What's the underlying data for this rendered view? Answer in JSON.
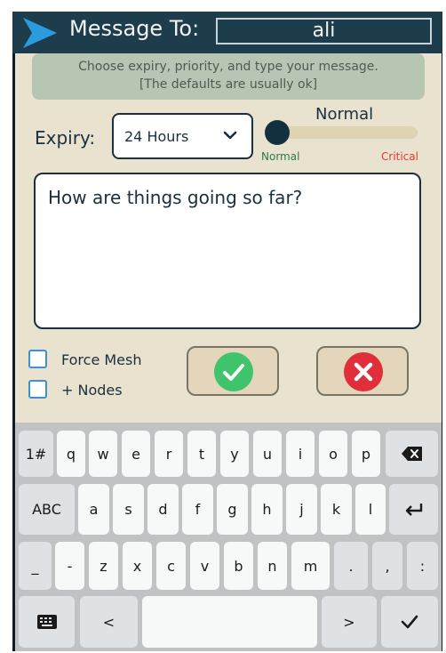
{
  "header": {
    "title": "Message To:",
    "recipient": "ali"
  },
  "hint": {
    "line1": "Choose expiry, priority, and type your message.",
    "line2": "[The defaults are usually ok]"
  },
  "expiry": {
    "label": "Expiry:",
    "selected": "24 Hours"
  },
  "priority": {
    "title": "Normal",
    "min_label": "Normal",
    "max_label": "Critical",
    "level": 0
  },
  "message": {
    "text": "How are things going so far?"
  },
  "options": {
    "force_mesh": "Force Mesh",
    "plus_nodes": "+ Nodes"
  },
  "colors": {
    "header": "#1d3d4c",
    "panel": "#e8e2cf",
    "accent_arrow": "#2b9be0",
    "confirm": "#3fc46b",
    "cancel": "#e02f3a"
  },
  "keyboard": {
    "row1": [
      "1#",
      "q",
      "w",
      "e",
      "r",
      "t",
      "y",
      "u",
      "i",
      "o",
      "p"
    ],
    "row2": [
      "ABC",
      "a",
      "s",
      "d",
      "f",
      "g",
      "h",
      "j",
      "k",
      "l"
    ],
    "row3": [
      "_",
      "-",
      "z",
      "x",
      "c",
      "v",
      "b",
      "n",
      "m",
      ".",
      ",",
      ":"
    ],
    "row4_left": "<",
    "row4_right": ">"
  }
}
